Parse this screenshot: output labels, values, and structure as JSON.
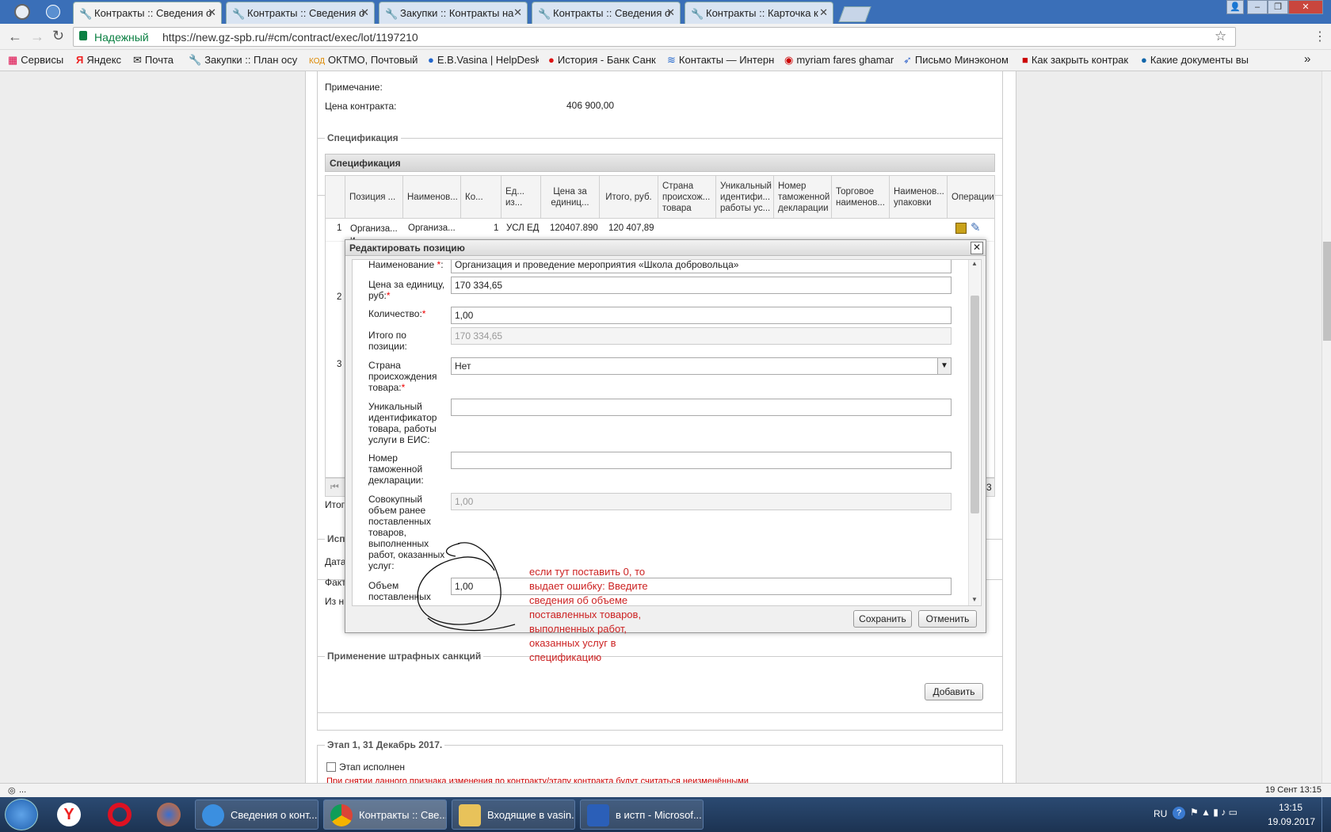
{
  "browser": {
    "tabs": [
      {
        "label": "Контракты :: Сведения о"
      },
      {
        "label": "Контракты :: Сведения о"
      },
      {
        "label": "Закупки :: Контракты на"
      },
      {
        "label": "Контракты :: Сведения о"
      },
      {
        "label": "Контракты :: Карточка к"
      }
    ],
    "secure_label": "Надежный",
    "url": "https://new.gz-spb.ru/#cm/contract/exec/lot/1197210",
    "bookmarks": [
      {
        "label": "Сервисы"
      },
      {
        "label": "Яндекс"
      },
      {
        "label": "Почта"
      },
      {
        "label": "Закупки :: План осу"
      },
      {
        "label": "ОКТМО, Почтовый и"
      },
      {
        "label": "E.B.Vasina | HelpDesk"
      },
      {
        "label": "История - Банк Санк"
      },
      {
        "label": "Контакты — Интерн"
      },
      {
        "label": "myriam fares ghamar"
      },
      {
        "label": "Письмо Минэконом"
      },
      {
        "label": "Как закрыть контрак"
      },
      {
        "label": "Какие документы вы"
      }
    ],
    "more": "»"
  },
  "contract": {
    "note_label": "Примечание:",
    "price_label": "Цена контракта:",
    "price_value": "406 900,00"
  },
  "spec": {
    "legend": "Спецификация",
    "header": "Спецификация",
    "columns": [
      "Позиция ...",
      "Наименов...",
      "Ко...",
      "Ед... из...",
      "Цена за единиц...",
      "Итого, руб.",
      "Страна происхож... товара",
      "Уникальный идентифи... работы ус...",
      "Номер таможенной декларации",
      "Торговое наименов...",
      "Наименов... упаковки",
      "Операции"
    ],
    "row1": {
      "num": "1",
      "position": "Организа... и",
      "name": "Организа...",
      "qty": "1",
      "unit": "УСЛ ЕД",
      "price": "120407.890",
      "total": "120 407,89"
    },
    "row_nums": [
      "2",
      "3"
    ],
    "pager_end": "3",
    "total_label": "Итог"
  },
  "sections": {
    "execution_legend": "Испо",
    "date_label": "Дата",
    "fact_label": "Факт",
    "from_label": "Из н",
    "penalties_legend": "Применение штрафных санкций",
    "add_button": "Добавить",
    "stage_legend": "Этап 1, 31 Декабрь 2017.",
    "stage_checkbox": "Этап исполнен",
    "stage_warning": "При снятии данного признака изменения по контракту/этапу контракта будут считаться неизменёнными"
  },
  "modal": {
    "title": "Редактировать позицию",
    "fields": {
      "name": {
        "label": "Наименование ",
        "value": "Организация и проведение мероприятия «Школа добровольца»"
      },
      "unit_price": {
        "label": "Цена за единицу, руб:",
        "value": "170 334,65"
      },
      "quantity": {
        "label": "Количество:",
        "value": "1,00"
      },
      "position_total": {
        "label": "Итого по позиции:",
        "value": "170 334,65"
      },
      "country": {
        "label": "Страна происхождения товара:",
        "value": "Нет"
      },
      "unique_id": {
        "label": "Уникальный идентификатор товара, работы услуги в ЕИС:",
        "value": ""
      },
      "customs": {
        "label": "Номер таможенной декларации:",
        "value": ""
      },
      "cumulative": {
        "label": "Совокупный объем ранее поставленных товаров, выполненных работ, оказанных услуг:",
        "value": "1,00"
      },
      "delivered": {
        "label": "Объем поставленных",
        "value": "1,00"
      }
    },
    "save_button": "Сохранить",
    "cancel_button": "Отменить"
  },
  "annotation": "если тут поставить 0, то выдает ошибку: Введите сведения об объеме поставленных товаров, выполненных работ, оказанных услуг в спецификацию",
  "status": {
    "left": "...",
    "date": "19 Сент 13:15"
  },
  "taskbar": {
    "items": [
      {
        "label": "Сведения о конт..."
      },
      {
        "label": "Контракты :: Све..."
      },
      {
        "label": "Входящие в vasin..."
      },
      {
        "label": "в истп - Microsof..."
      }
    ],
    "lang": "RU",
    "time": "13:15",
    "date": "19.09.2017"
  }
}
